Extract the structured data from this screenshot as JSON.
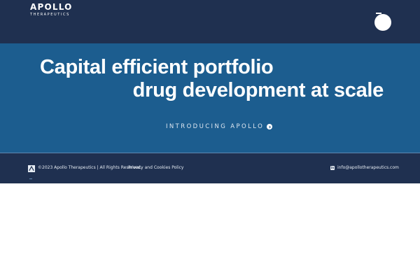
{
  "header": {
    "logo": {
      "main": "APOLLO",
      "sub": "THERAPEUTICS"
    },
    "menu_button_icon": "circle-menu-icon"
  },
  "hero": {
    "line1": "Capital efficient portfolio",
    "line2": "drug development at scale",
    "link_label": "INTRODUCING APOLLO",
    "link_icon": "chevron-right-circle-icon"
  },
  "footer": {
    "logo_icon": "apollo-mark-icon",
    "copyright": "©2023 Apollo Therapeutics | All Rights Reserved.",
    "privacy_label": "Privacy and Cookies Policy",
    "contact_icon": "linkedin-icon",
    "email": "info@apollotherapeutics.com"
  },
  "colors": {
    "header_background": "#1f3050",
    "hero_background": "#1c5d8f",
    "text": "#ffffff"
  }
}
